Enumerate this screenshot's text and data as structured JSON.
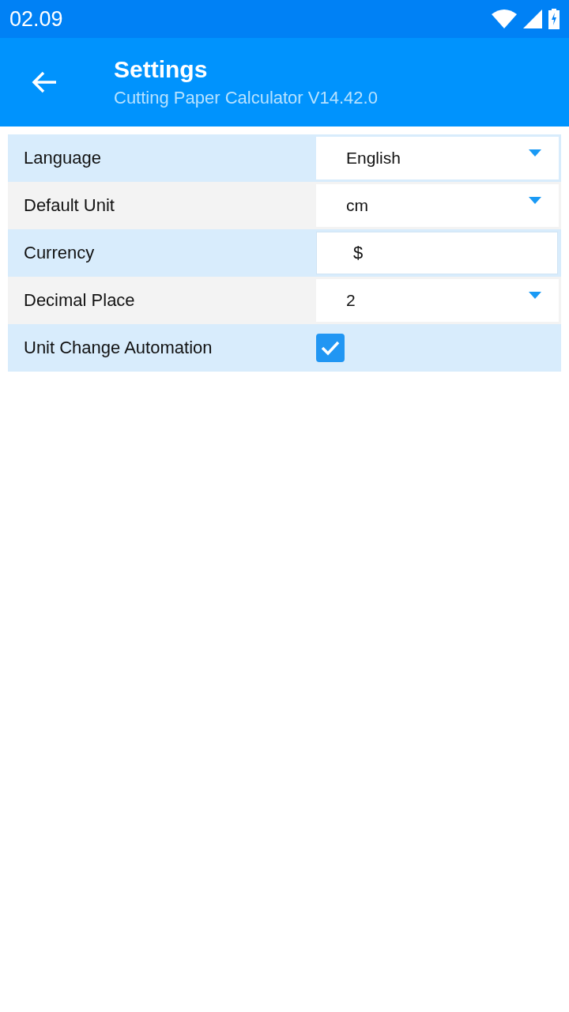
{
  "status_bar": {
    "time": "02.09"
  },
  "app_bar": {
    "title": "Settings",
    "subtitle": "Cutting Paper Calculator V14.42.0"
  },
  "settings": [
    {
      "kind": "dropdown",
      "label": "Language",
      "value": "English"
    },
    {
      "kind": "dropdown",
      "label": "Default Unit",
      "value": "cm"
    },
    {
      "kind": "text",
      "label": "Currency",
      "value": "$"
    },
    {
      "kind": "dropdown",
      "label": "Decimal Place",
      "value": "2"
    },
    {
      "kind": "checkbox",
      "label": "Unit Change Automation",
      "checked": true
    }
  ]
}
